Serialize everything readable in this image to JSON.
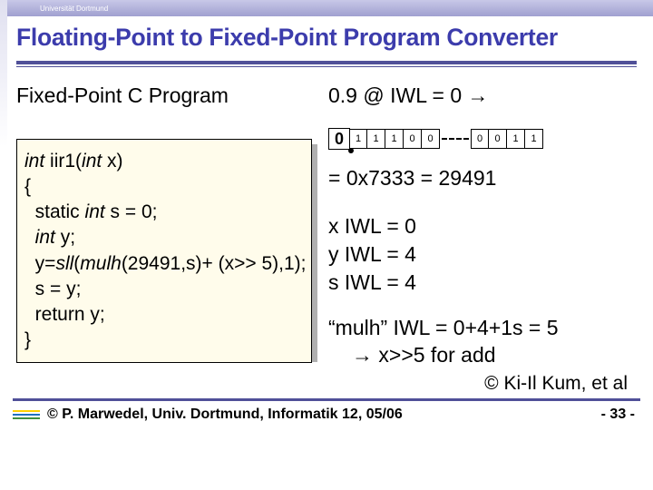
{
  "topbar": {
    "text": "Universität Dortmund"
  },
  "title": "Floating-Point to Fixed-Point Program Converter",
  "left": {
    "subhead": "Fixed-Point C Program",
    "code_l1a": "int",
    "code_l1b": " iir1(",
    "code_l1c": "int",
    "code_l1d": " x)",
    "code_l2": "{",
    "code_l3a": "  static ",
    "code_l3b": "int",
    "code_l3c": " s = 0;",
    "code_l4a": "  ",
    "code_l4b": "int",
    "code_l4c": " y;",
    "code_l5a": "  y=",
    "code_l5b": "sll",
    "code_l5c": "(",
    "code_l5d": "mulh",
    "code_l5e": "(29491,s)+ (x>> 5),1);",
    "code_l6": "  s = y;",
    "code_l7": "  return y;",
    "code_l8": "}"
  },
  "right": {
    "expr": "0.9 @ IWL = 0 →",
    "bits_big": "0",
    "bits_left": [
      "1",
      "1",
      "1",
      "0",
      "0"
    ],
    "bits_right": [
      "0",
      "0",
      "1",
      "1"
    ],
    "eq": "= 0x7333 = 29491",
    "iwl_x": "x IWL = 0",
    "iwl_y": "y IWL = 4",
    "iwl_s": "s IWL = 4",
    "mulh1": "“mulh” IWL = 0+4+1s = 5",
    "mulh2": "→ x>>5  for add"
  },
  "credit": "© Ki-Il Kum, et al",
  "footer": {
    "text": "© P. Marwedel, Univ. Dortmund, Informatik 12, 05/06",
    "page": "-  33  -"
  }
}
